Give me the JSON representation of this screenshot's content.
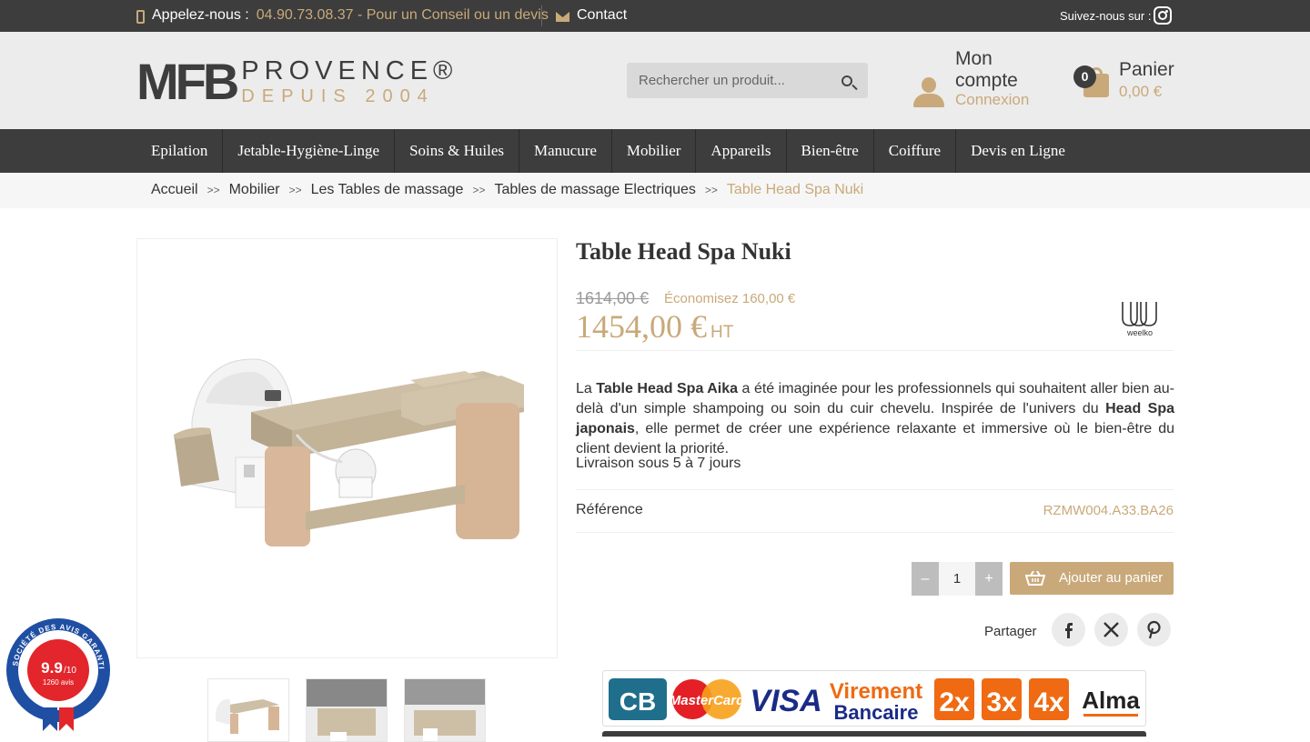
{
  "topbar": {
    "phone_label": "Appelez-nous :",
    "phone_value": "04.90.73.08.37 - Pour un Conseil ou un devis",
    "contact_label": "Contact",
    "follow_label": "Suivez-nous sur :"
  },
  "logo": {
    "mark": "MFB",
    "line1": "PROVENCE®",
    "line2": "DEPUIS 2004"
  },
  "search": {
    "placeholder": "Rechercher un produit..."
  },
  "account": {
    "title": "Mon compte",
    "link": "Connexion"
  },
  "cart": {
    "title": "Panier",
    "amount": "0,00 €",
    "count": "0"
  },
  "nav": {
    "items": [
      {
        "label": "Epilation"
      },
      {
        "label": "Jetable-Hygiène-Linge"
      },
      {
        "label": "Soins & Huiles"
      },
      {
        "label": "Manucure"
      },
      {
        "label": "Mobilier"
      },
      {
        "label": "Appareils"
      },
      {
        "label": "Bien-être"
      },
      {
        "label": "Coiffure"
      },
      {
        "label": "Devis en Ligne"
      }
    ]
  },
  "breadcrumb": {
    "items": [
      "Accueil",
      "Mobilier",
      "Les Tables de massage",
      "Tables de massage Electriques"
    ],
    "current": "Table Head Spa Nuki",
    "separator": ">>"
  },
  "product": {
    "title": "Table Head Spa Nuki",
    "old_price": "1614,00 €",
    "savings": "Économisez 160,00 €",
    "price": "1454,00 €",
    "price_suffix": "HT",
    "brand": "weelko",
    "desc_intro": "La ",
    "desc_bold1": "Table Head Spa Aika",
    "desc_mid": " a été imaginée pour les professionnels qui souhaitent aller bien au-delà d'un simple shampoing ou soin du cuir chevelu. Inspirée de l'univers du ",
    "desc_bold2": "Head Spa japonais",
    "desc_end": ", elle permet de créer une expérience relaxante et immersive où le bien-être du client devient la priorité.",
    "delivery": "Livraison sous 5 à 7 jours",
    "reference_label": "Référence",
    "reference_value": "RZMW004.A33.BA26",
    "quantity": "1",
    "minus": "–",
    "plus": "+",
    "add_to_cart": "Ajouter au panier",
    "share_label": "Partager"
  },
  "payments": [
    "CB",
    "MasterCard",
    "VISA",
    "Virement",
    "Bancaire",
    "2x",
    "3x",
    "4x",
    "Alma"
  ],
  "badge": {
    "score": "9.9",
    "scale": "/10",
    "count": "1260 avis",
    "ring_text": "SOCIÉTÉ DES AVIS GARANTIS"
  },
  "colors": {
    "accent": "#c9a97a",
    "dark": "#3d3d3d"
  }
}
